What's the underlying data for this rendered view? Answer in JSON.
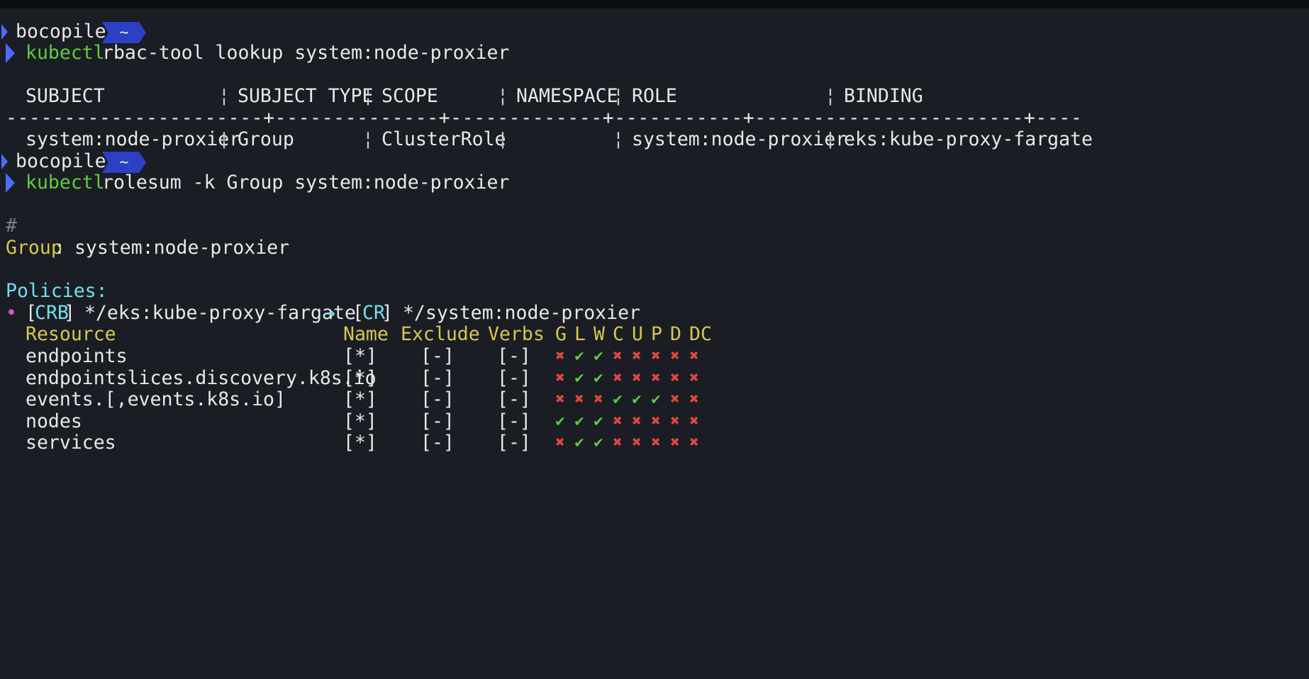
{
  "colors": {
    "background": "#1a1d23",
    "command": "#5fcc3e",
    "yellow_header": "#d7c84a",
    "cyan_label": "#6fe0ee",
    "prompt_badge": "#2b3fc7",
    "allowed": "#5fcc3e",
    "denied": "#d8483f"
  },
  "prompt1": {
    "user": "bocopile",
    "badge": "~"
  },
  "command1": {
    "cmd": "kubectl",
    "args": "rbac-tool lookup system:node-proxier"
  },
  "rbac_table": {
    "separator": "¦",
    "headers": [
      "SUBJECT",
      "SUBJECT TYPE",
      "SCOPE",
      "NAMESPACE",
      "ROLE",
      "BINDING"
    ],
    "divider": "----------------------+--------------+-------------+-----------+-----------------------+--------------------------",
    "row": [
      "system:node-proxier",
      "Group",
      "ClusterRole",
      "",
      "system:node-proxier",
      "eks:kube-proxy-fargate"
    ]
  },
  "prompt2": {
    "user": "bocopile",
    "badge": "~"
  },
  "command2": {
    "cmd": "kubectl",
    "args": "rolesum -k Group system:node-proxier"
  },
  "rolesum": {
    "hash": "#",
    "subject_kind": "Group",
    "subject_colon": ":",
    "subject_name": " system:node-proxier",
    "policies_label": "Policies:",
    "policy": {
      "bullet": "•",
      "open1": "[",
      "kind1": "CRB",
      "close1": "]",
      "binding": " */eks:kube-proxy-fargate",
      "arrow": "→",
      "open2": "[",
      "kind2": "CR",
      "close2": "]",
      "role": " */system:node-proxier"
    },
    "columns": {
      "resource": "Resource",
      "name": "Name",
      "exclude": "Exclude",
      "verbs": "Verbs",
      "verb_flags": [
        "G",
        "L",
        "W",
        "C",
        "U",
        "P",
        "D",
        "DC"
      ]
    },
    "rows": [
      {
        "resource": "endpoints",
        "name": "[*]",
        "exclude": "[-]",
        "verbs": "[-]",
        "flags": [
          false,
          true,
          true,
          false,
          false,
          false,
          false,
          false
        ]
      },
      {
        "resource": "endpointslices.discovery.k8s.io",
        "name": "[*]",
        "exclude": "[-]",
        "verbs": "[-]",
        "flags": [
          false,
          true,
          true,
          false,
          false,
          false,
          false,
          false
        ]
      },
      {
        "resource": "events.[,events.k8s.io]",
        "name": "[*]",
        "exclude": "[-]",
        "verbs": "[-]",
        "flags": [
          false,
          false,
          false,
          true,
          true,
          true,
          false,
          false
        ]
      },
      {
        "resource": "nodes",
        "name": "[*]",
        "exclude": "[-]",
        "verbs": "[-]",
        "flags": [
          true,
          true,
          true,
          false,
          false,
          false,
          false,
          false
        ]
      },
      {
        "resource": "services",
        "name": "[*]",
        "exclude": "[-]",
        "verbs": "[-]",
        "flags": [
          false,
          true,
          true,
          false,
          false,
          false,
          false,
          false
        ]
      }
    ],
    "glyph_yes": "✔",
    "glyph_no": "✖"
  }
}
